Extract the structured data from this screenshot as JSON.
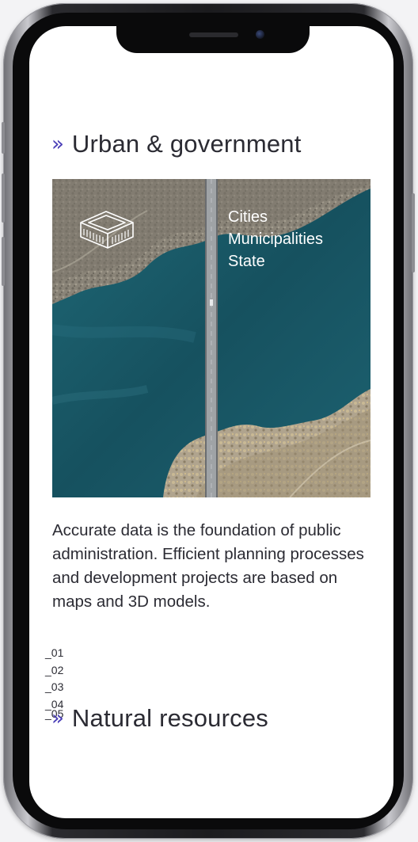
{
  "sections": [
    {
      "title": "Urban & government",
      "chevron": "»",
      "image": {
        "description_icon": "building-outline-icon",
        "labels": [
          "Cities",
          "Municipalities",
          "State"
        ]
      },
      "body": "Accurate data is the foundation of public administration. Efficient planning processes and development projects are based on maps and 3D models."
    },
    {
      "title": "Natural resources",
      "chevron": "»"
    }
  ],
  "index": [
    "_01",
    "_02",
    "_03",
    "_04",
    "_05"
  ],
  "colors": {
    "accent": "#4b3fb8",
    "text": "#2b2b33",
    "water": "#1e5a6b"
  }
}
